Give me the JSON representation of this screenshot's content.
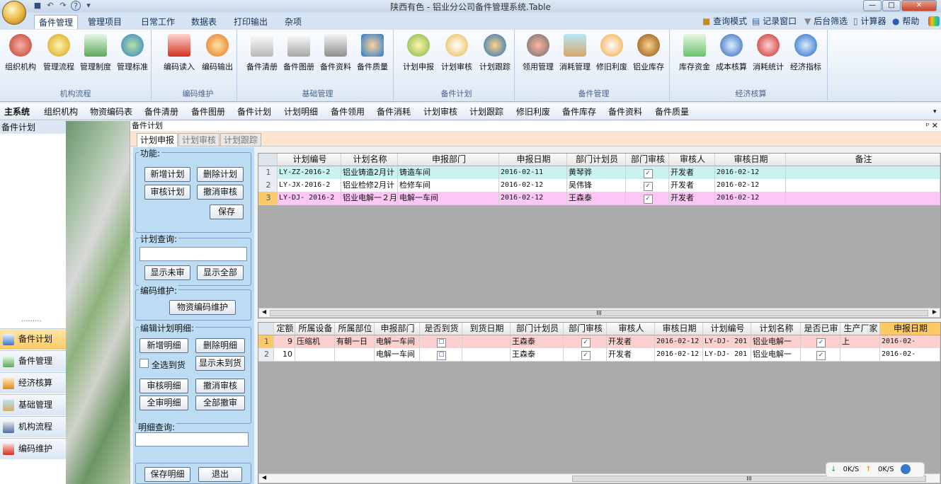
{
  "window": {
    "title": "陕西有色 - 铝业分公司备件管理系统.Table",
    "minimize": "—",
    "maximize": "□",
    "close": "✕"
  },
  "quick_access": {
    "save": "■",
    "undo": "↶",
    "redo": "↷",
    "help": "?",
    "more": "▾"
  },
  "ribbon_tabs": [
    "备件管理",
    "管理项目",
    "日常工作",
    "数据表",
    "打印输出",
    "杂项"
  ],
  "ribbon_tools": [
    "查询模式",
    "记录窗口",
    "后台筛选",
    "计算器",
    "帮助"
  ],
  "ribbon_groups": [
    {
      "label": "机构流程",
      "buttons": [
        "组织机构",
        "管理流程",
        "管理制度",
        "管理标准"
      ]
    },
    {
      "label": "编码维护",
      "buttons": [
        "编码读入",
        "编码输出"
      ]
    },
    {
      "label": "基础管理",
      "buttons": [
        "备件清册",
        "备件图册",
        "备件资料",
        "备件质量"
      ]
    },
    {
      "label": "备件计划",
      "buttons": [
        "计划申报",
        "计划审核",
        "计划跟踪"
      ]
    },
    {
      "label": "备件管理",
      "buttons": [
        "领用管理",
        "消耗管理",
        "修旧利废",
        "铝业库存"
      ]
    },
    {
      "label": "经济核算",
      "buttons": [
        "库存资金",
        "成本核算",
        "消耗统计",
        "经济指标"
      ]
    }
  ],
  "module_nav": [
    "主系统",
    "组织机构",
    "物资编码表",
    "备件清册",
    "备件图册",
    "备件计划",
    "计划明细",
    "备件领用",
    "备件消耗",
    "计划审核",
    "计划跟踪",
    "修旧利废",
    "备件库存",
    "备件资料",
    "备件质量"
  ],
  "sidebar": {
    "header": "备件计划",
    "dots": "·········",
    "items": [
      "备件计划",
      "备件管理",
      "经济核算",
      "基础管理",
      "机构流程",
      "编码维护"
    ]
  },
  "main": {
    "caption": "备件计划",
    "pin": "ᵖ ✕",
    "subtabs": [
      "计划申报",
      "计划审核",
      "计划跟踪"
    ]
  },
  "func_panel": {
    "group_func": "功能:",
    "btn_add_plan": "新增计划",
    "btn_del_plan": "删除计划",
    "btn_audit_plan": "审核计划",
    "btn_cancel_audit": "撤消审核",
    "btn_save": "保存",
    "group_query": "计划查询:",
    "btn_show_unaudited": "显示未审",
    "btn_show_all": "显示全部",
    "group_code": "编码维护:",
    "btn_code_maint": "物资编码维护",
    "group_detail": "编辑计划明细:",
    "btn_add_detail": "新增明细",
    "btn_del_detail": "删除明细",
    "chk_select_all": "全选到货",
    "btn_show_not_arrived": "显示未到货",
    "btn_audit_detail": "审核明细",
    "btn_cancel_audit_detail": "撤消审核",
    "btn_audit_all": "全审明细",
    "btn_cancel_all": "全部撤审",
    "group_detail_query": "明细查询:",
    "btn_save_detail": "保存明细",
    "btn_exit": "退出"
  },
  "top_grid": {
    "columns": [
      "计划编号",
      "计划名称",
      "申报部门",
      "申报日期",
      "部门计划员",
      "部门审核",
      "审核人",
      "审核日期",
      "备注"
    ],
    "rows": [
      {
        "n": "1",
        "cells": [
          "LY-ZZ-2016-2",
          "铝业铸造2月计",
          "铸造车间",
          "2016-02-11",
          "黄琴骅",
          "✓",
          "开发者",
          "2016-02-12",
          ""
        ]
      },
      {
        "n": "2",
        "cells": [
          "LY-JX-2016-2",
          "铝业检修2月计",
          "检修车间",
          "2016-02-12",
          "吴伟锋",
          "✓",
          "开发者",
          "2016-02-12",
          ""
        ]
      },
      {
        "n": "3",
        "cells": [
          "LY-DJ- 2016-2",
          "铝业电解一２月",
          "电解一车间",
          "2016-02-12",
          "王森泰",
          "✓",
          "开发者",
          "2016-02-12",
          ""
        ]
      }
    ],
    "scroll_mark": "III"
  },
  "bottom_grid": {
    "columns": [
      "定额",
      "所属设备",
      "所属部位",
      "申报部门",
      "是否到货",
      "到货日期",
      "部门计划员",
      "部门审核",
      "审核人",
      "审核日期",
      "计划编号",
      "计划名称",
      "是否已审",
      "生产厂家",
      "申报日期"
    ],
    "rows": [
      {
        "n": "1",
        "cells": [
          "9",
          "压缩机",
          "有朝一日",
          "电解一车间",
          "☐",
          "",
          "王森泰",
          "✓",
          "开发者",
          "2016-02-12",
          "LY-DJ- 201",
          "铝业电解一",
          "✓",
          "上",
          "2016-02-"
        ]
      },
      {
        "n": "2",
        "cells": [
          "10",
          "",
          "",
          "电解一车间",
          "☐",
          "",
          "王森泰",
          "✓",
          "开发者",
          "2016-02-12",
          "LY-DJ- 201",
          "铝业电解一",
          "✓",
          "",
          "2016-02-"
        ]
      }
    ],
    "scroll_mark": "III"
  },
  "status": {
    "down": "0K/S",
    "up": "0K/S"
  },
  "colors": {
    "row1": "#c9f2f0",
    "row3": "#fcc6f5",
    "brow1": "#fbd0cf",
    "accent": "#fbc965"
  }
}
